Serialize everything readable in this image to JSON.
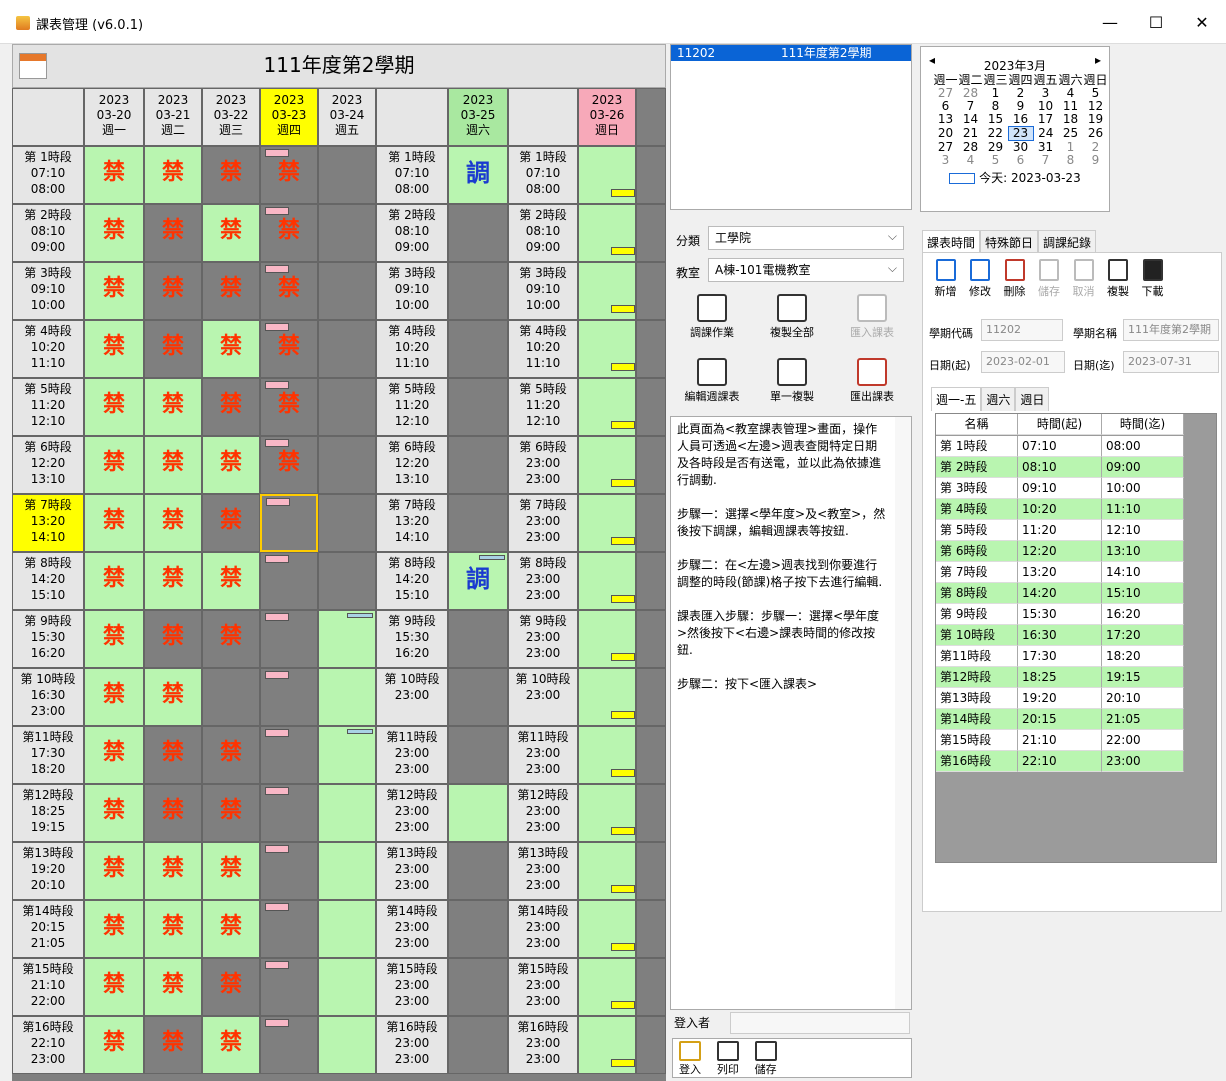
{
  "window": {
    "title": "課表管理 (v6.0.1)",
    "minimize": "—",
    "maximize": "☐",
    "close": "✕"
  },
  "semester_title": "111年度第2學期",
  "days": [
    {
      "line1": "2023",
      "line2": "03-20",
      "line3": "週一",
      "type": "normal"
    },
    {
      "line1": "2023",
      "line2": "03-21",
      "line3": "週二",
      "type": "normal"
    },
    {
      "line1": "2023",
      "line2": "03-22",
      "line3": "週三",
      "type": "normal"
    },
    {
      "line1": "2023",
      "line2": "03-23",
      "line3": "週四",
      "type": "today"
    },
    {
      "line1": "2023",
      "line2": "03-24",
      "line3": "週五",
      "type": "normal"
    },
    {
      "line1": "2023",
      "line2": "03-25",
      "line3": "週六",
      "type": "sat"
    },
    {
      "line1": "2023",
      "line2": "03-26",
      "line3": "週日",
      "type": "sun"
    }
  ],
  "periods": [
    {
      "name": "第 1時段",
      "start": "07:10",
      "end": "08:00"
    },
    {
      "name": "第 2時段",
      "start": "08:10",
      "end": "09:00"
    },
    {
      "name": "第 3時段",
      "start": "09:10",
      "end": "10:00"
    },
    {
      "name": "第 4時段",
      "start": "10:20",
      "end": "11:10"
    },
    {
      "name": "第 5時段",
      "start": "11:20",
      "end": "12:10"
    },
    {
      "name": "第 6時段",
      "start": "12:20",
      "end": "13:10"
    },
    {
      "name": "第 7時段",
      "start": "13:20",
      "end": "14:10"
    },
    {
      "name": "第 8時段",
      "start": "14:20",
      "end": "15:10"
    },
    {
      "name": "第 9時段",
      "start": "15:30",
      "end": "16:20"
    },
    {
      "name": "第 10時段",
      "start": "16:30",
      "end": "23:00"
    },
    {
      "name": "第11時段",
      "start": "17:30",
      "end": "18:20"
    },
    {
      "name": "第12時段",
      "start": "18:25",
      "end": "19:15"
    },
    {
      "name": "第13時段",
      "start": "19:20",
      "end": "20:10"
    },
    {
      "name": "第14時段",
      "start": "20:15",
      "end": "21:05"
    },
    {
      "name": "第15時段",
      "start": "21:10",
      "end": "22:00"
    },
    {
      "name": "第16時段",
      "start": "22:10",
      "end": "23:00"
    }
  ],
  "col1_times": [
    {
      "name": "第 1時段",
      "start": "07:10",
      "end": "08:00"
    },
    {
      "name": "第 2時段",
      "start": "08:10",
      "end": "09:00"
    },
    {
      "name": "第 3時段",
      "start": "09:10",
      "end": "10:00"
    },
    {
      "name": "第 4時段",
      "start": "10:20",
      "end": "11:10"
    },
    {
      "name": "第 5時段",
      "start": "11:20",
      "end": "12:10"
    },
    {
      "name": "第 6時段",
      "start": "12:20",
      "end": "13:10"
    },
    {
      "name": "第 7時段",
      "start": "13:20",
      "end": "14:10"
    },
    {
      "name": "第 8時段",
      "start": "14:20",
      "end": "15:10"
    },
    {
      "name": "第 9時段",
      "start": "15:30",
      "end": "16:20"
    },
    {
      "name": "第 10時段",
      "start": "16:30",
      "end": "23:00"
    },
    {
      "name": "第11時段",
      "start": "17:30",
      "end": "18:20"
    },
    {
      "name": "第12時段",
      "start": "18:25",
      "end": "19:15"
    },
    {
      "name": "第13時段",
      "start": "19:20",
      "end": "20:10"
    },
    {
      "name": "第14時段",
      "start": "20:15",
      "end": "21:05"
    },
    {
      "name": "第15時段",
      "start": "21:10",
      "end": "22:00"
    },
    {
      "name": "第16時段",
      "start": "22:10",
      "end": "23:00"
    }
  ],
  "sat_times": [
    {
      "name": "第 1時段",
      "start": "07:10",
      "end": "08:00"
    },
    {
      "name": "第 2時段",
      "start": "08:10",
      "end": "09:00"
    },
    {
      "name": "第 3時段",
      "start": "09:10",
      "end": "10:00"
    },
    {
      "name": "第 4時段",
      "start": "10:20",
      "end": "11:10"
    },
    {
      "name": "第 5時段",
      "start": "11:20",
      "end": "12:10"
    },
    {
      "name": "第 6時段",
      "start": "12:20",
      "end": "13:10"
    },
    {
      "name": "第 7時段",
      "start": "13:20",
      "end": "14:10"
    },
    {
      "name": "第 8時段",
      "start": "14:20",
      "end": "15:10"
    },
    {
      "name": "第 9時段",
      "start": "15:30",
      "end": "16:20"
    },
    {
      "name": "第 10時段",
      "start": "23:00",
      "end": ""
    },
    {
      "name": "第11時段",
      "start": "23:00",
      "end": "23:00"
    },
    {
      "name": "第12時段",
      "start": "23:00",
      "end": "23:00"
    },
    {
      "name": "第13時段",
      "start": "23:00",
      "end": "23:00"
    },
    {
      "name": "第14時段",
      "start": "23:00",
      "end": "23:00"
    },
    {
      "name": "第15時段",
      "start": "23:00",
      "end": "23:00"
    },
    {
      "name": "第16時段",
      "start": "23:00",
      "end": "23:00"
    }
  ],
  "sun_times": [
    {
      "name": "第 1時段",
      "start": "07:10",
      "end": "08:00"
    },
    {
      "name": "第 2時段",
      "start": "08:10",
      "end": "09:00"
    },
    {
      "name": "第 3時段",
      "start": "09:10",
      "end": "10:00"
    },
    {
      "name": "第 4時段",
      "start": "10:20",
      "end": "11:10"
    },
    {
      "name": "第 5時段",
      "start": "11:20",
      "end": "12:10"
    },
    {
      "name": "第 6時段",
      "start": "23:00",
      "end": "23:00"
    },
    {
      "name": "第 7時段",
      "start": "23:00",
      "end": "23:00"
    },
    {
      "name": "第 8時段",
      "start": "23:00",
      "end": "23:00"
    },
    {
      "name": "第 9時段",
      "start": "23:00",
      "end": "23:00"
    },
    {
      "name": "第 10時段",
      "start": "23:00",
      "end": ""
    },
    {
      "name": "第11時段",
      "start": "23:00",
      "end": "23:00"
    },
    {
      "name": "第12時段",
      "start": "23:00",
      "end": "23:00"
    },
    {
      "name": "第13時段",
      "start": "23:00",
      "end": "23:00"
    },
    {
      "name": "第14時段",
      "start": "23:00",
      "end": "23:00"
    },
    {
      "name": "第15時段",
      "start": "23:00",
      "end": "23:00"
    },
    {
      "name": "第16時段",
      "start": "23:00",
      "end": "23:00"
    }
  ],
  "sat_override": {
    "name": "第 10時段",
    "start": "段",
    "end": "23:00"
  },
  "ban_label": "禁",
  "adjust_label": "調",
  "semester_list": {
    "code": "11202",
    "name": "111年度第2學期"
  },
  "category": {
    "label": "分類",
    "value": "工學院"
  },
  "room": {
    "label": "教室",
    "value": "A棟-101電機教室"
  },
  "buttons": {
    "adjust": "調課作業",
    "copy_all": "複製全部",
    "import": "匯入課表",
    "edit_week": "編輯週課表",
    "single_copy": "單一複製",
    "export": "匯出課表"
  },
  "help": [
    "此頁面為<教室課表管理>畫面，操作人員可透過<左邊>週表查閱特定日期及各時段是否有送電，並以此為依據進行調動.",
    "步驟一：選擇<學年度>及<教室>，然後按下調課，編輯週課表等按鈕.",
    "步驟二：在<左邊>週表找到你要進行調整的時段(節課)格子按下去進行編輯.",
    "課表匯入步驟：步驟一：選擇<學年度>然後按下<右邊>課表時間的修改按鈕.",
    "步驟二：按下<匯入課表>"
  ],
  "login": {
    "label": "登入者",
    "btn_login": "登入",
    "btn_print": "列印",
    "btn_save": "儲存"
  },
  "calendar": {
    "title": "2023年3月",
    "weekdays": [
      "週一",
      "週二",
      "週三",
      "週四",
      "週五",
      "週六",
      "週日"
    ],
    "rows": [
      [
        "27",
        "28",
        "1",
        "2",
        "3",
        "4",
        "5"
      ],
      [
        "6",
        "7",
        "8",
        "9",
        "10",
        "11",
        "12"
      ],
      [
        "13",
        "14",
        "15",
        "16",
        "17",
        "18",
        "19"
      ],
      [
        "20",
        "21",
        "22",
        "23",
        "24",
        "25",
        "26"
      ],
      [
        "27",
        "28",
        "29",
        "30",
        "31",
        "1",
        "2"
      ],
      [
        "3",
        "4",
        "5",
        "6",
        "7",
        "8",
        "9"
      ]
    ],
    "today": "今天: 2023-03-23"
  },
  "rtabs": [
    "課表時間",
    "特殊節日",
    "調課紀錄"
  ],
  "toolbar": {
    "add": "新增",
    "edit": "修改",
    "delete": "刪除",
    "save": "儲存",
    "cancel": "取消",
    "copy": "複製",
    "download": "下載"
  },
  "fields": {
    "code_label": "學期代碼",
    "code": "11202",
    "name_label": "學期名稱",
    "name": "111年度第2學期",
    "start_label": "日期(起)",
    "start": "2023-02-01",
    "end_label": "日期(迄)",
    "end": "2023-07-31"
  },
  "subtabs": [
    "週一-五",
    "週六",
    "週日"
  ],
  "table": {
    "headers": [
      "名稱",
      "時間(起)",
      "時間(迄)"
    ],
    "rows": [
      [
        "第 1時段",
        "07:10",
        "08:00"
      ],
      [
        "第 2時段",
        "08:10",
        "09:00"
      ],
      [
        "第 3時段",
        "09:10",
        "10:00"
      ],
      [
        "第 4時段",
        "10:20",
        "11:10"
      ],
      [
        "第 5時段",
        "11:20",
        "12:10"
      ],
      [
        "第 6時段",
        "12:20",
        "13:10"
      ],
      [
        "第 7時段",
        "13:20",
        "14:10"
      ],
      [
        "第 8時段",
        "14:20",
        "15:10"
      ],
      [
        "第 9時段",
        "15:30",
        "16:20"
      ],
      [
        "第 10時段",
        "16:30",
        "17:20"
      ],
      [
        "第11時段",
        "17:30",
        "18:20"
      ],
      [
        "第12時段",
        "18:25",
        "19:15"
      ],
      [
        "第13時段",
        "19:20",
        "20:10"
      ],
      [
        "第14時段",
        "20:15",
        "21:05"
      ],
      [
        "第15時段",
        "21:10",
        "22:00"
      ],
      [
        "第16時段",
        "22:10",
        "23:00"
      ]
    ]
  }
}
